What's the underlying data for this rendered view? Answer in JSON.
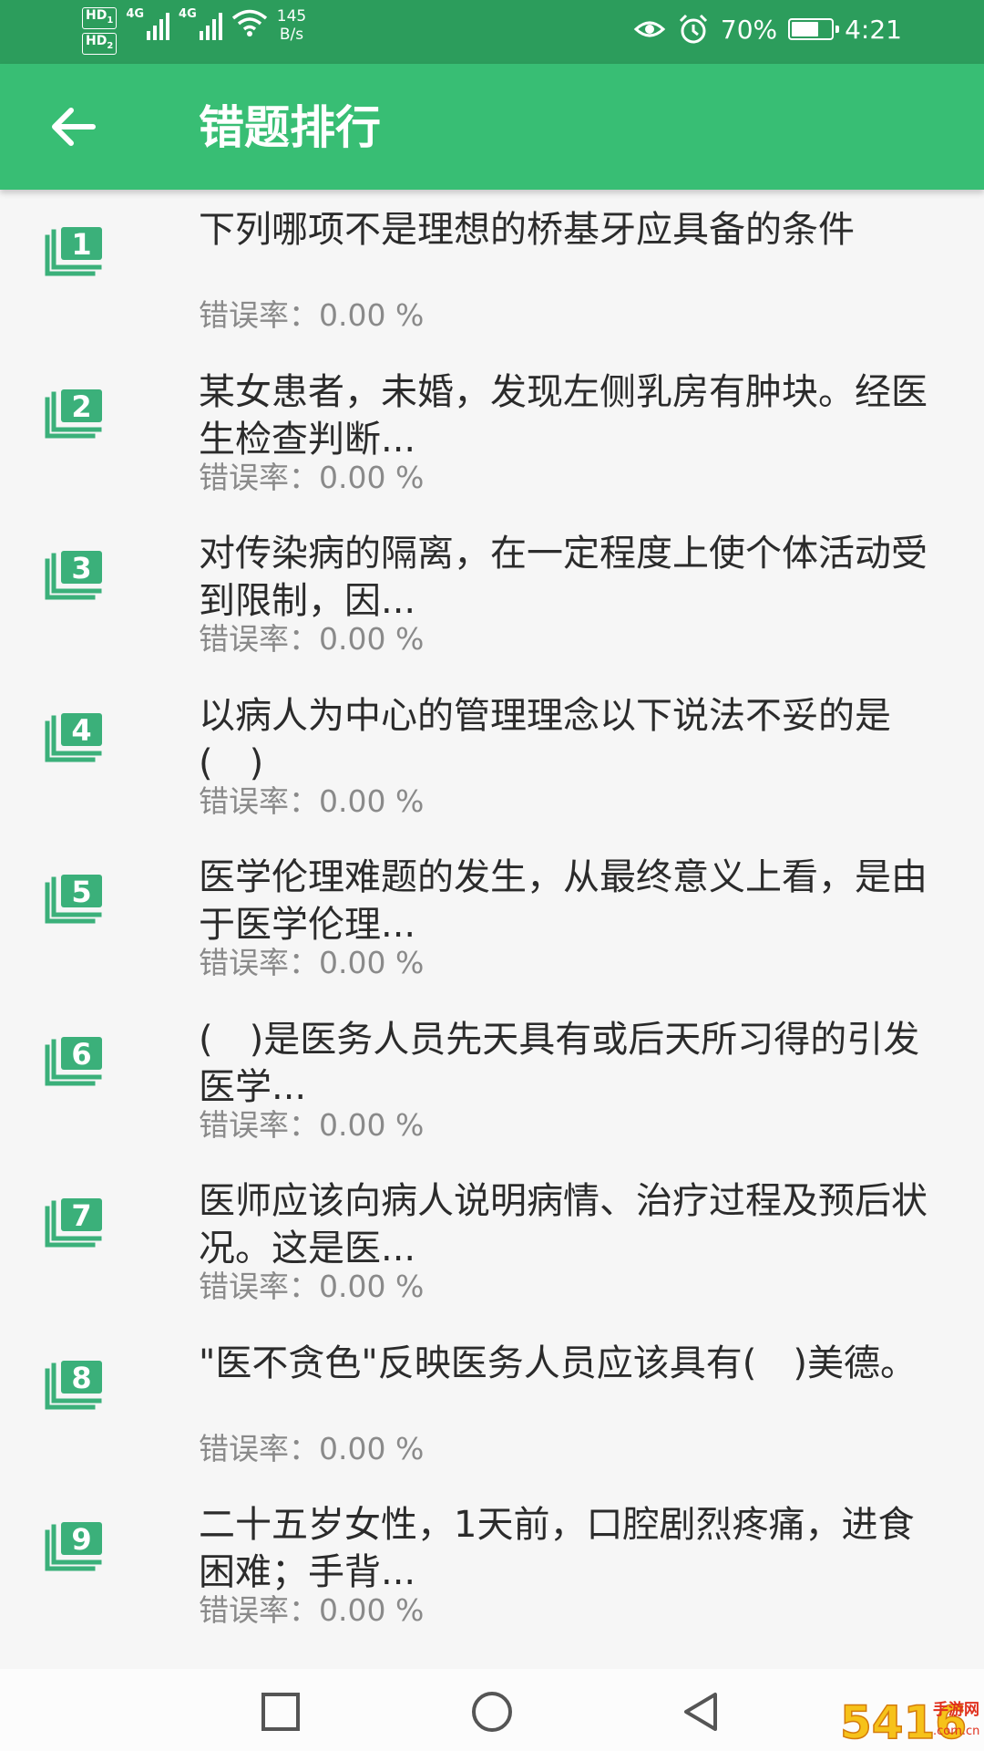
{
  "status_bar": {
    "sim1": "HD",
    "sim1_num": "1",
    "sim2": "HD",
    "sim2_num": "2",
    "net1": "4G",
    "net2": "4G",
    "speed_value": "145",
    "speed_unit": "B/s",
    "battery": "70%",
    "battery_level": 0.7,
    "time": "4:21"
  },
  "header": {
    "title": "错题排行"
  },
  "questions": [
    {
      "rank": "1",
      "text": "下列哪项不是理想的桥基牙应具备的条件",
      "rate": "错误率：0.00 %"
    },
    {
      "rank": "2",
      "text": "某女患者，未婚，发现左侧乳房有肿块。经医生检查判断...",
      "rate": "错误率：0.00 %"
    },
    {
      "rank": "3",
      "text": "对传染病的隔离，在一定程度上使个体活动受到限制，因...",
      "rate": "错误率：0.00 %"
    },
    {
      "rank": "4",
      "text": "以病人为中心的管理理念以下说法不妥的是(　)",
      "rate": "错误率：0.00 %"
    },
    {
      "rank": "5",
      "text": "医学伦理难题的发生，从最终意义上看，是由于医学伦理...",
      "rate": "错误率：0.00 %"
    },
    {
      "rank": "6",
      "text": "(　)是医务人员先天具有或后天所习得的引发医学...",
      "rate": "错误率：0.00 %"
    },
    {
      "rank": "7",
      "text": "医师应该向病人说明病情、治疗过程及预后状况。这是医...",
      "rate": "错误率：0.00 %"
    },
    {
      "rank": "8",
      "text": "\"医不贪色\"反映医务人员应该具有(　)美德。",
      "rate": "错误率：0.00 %"
    },
    {
      "rank": "9",
      "text": "二十五岁女性，1天前，口腔剧烈疼痛，进食困难；手背...",
      "rate": "错误率：0.00 %"
    }
  ],
  "watermark": {
    "logo": "5416",
    "text_top": "手游网",
    "text_bottom": ".com.cn"
  },
  "colors": {
    "status_bar": "#2c9d5c",
    "app_bar": "#38be74",
    "icon_green": "#3bb07a",
    "text": "#2b2b2b",
    "subtext": "#8a8a8a"
  }
}
